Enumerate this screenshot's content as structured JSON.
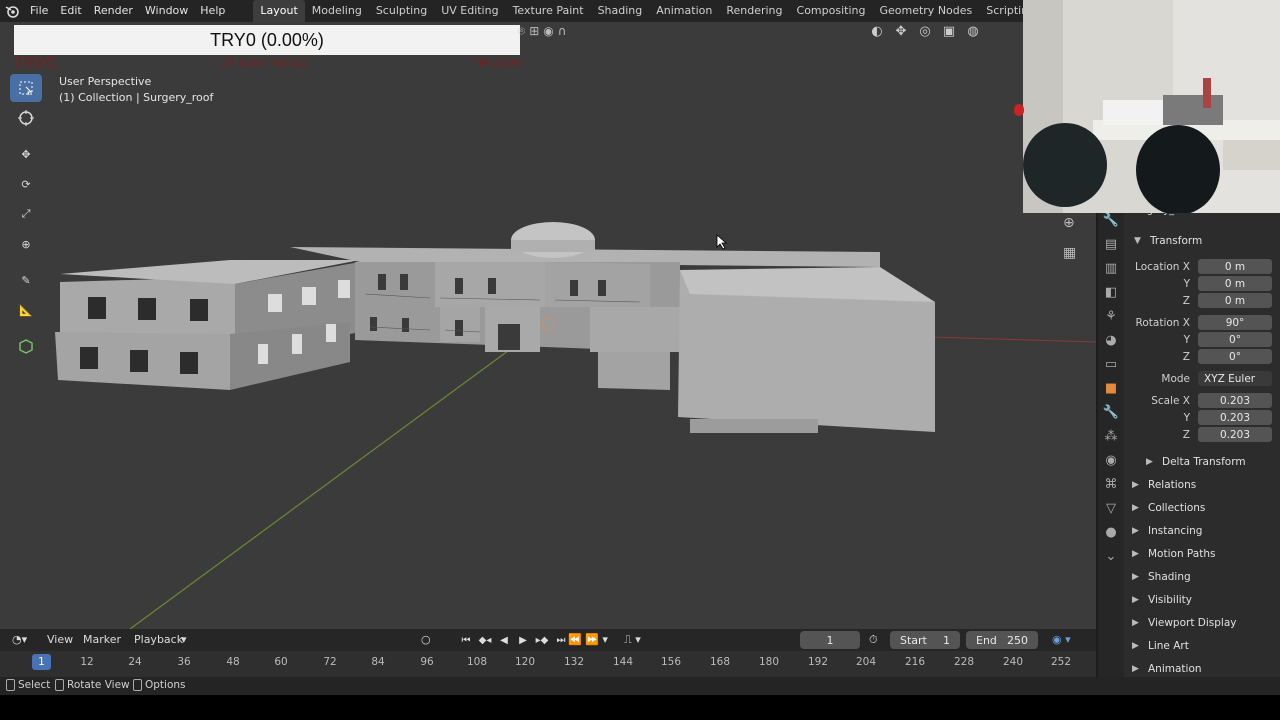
{
  "menubar": {
    "logo_icon": "blender-logo-icon",
    "items": [
      "File",
      "Edit",
      "Render",
      "Window",
      "Help"
    ],
    "workspaces": [
      "Layout",
      "Modeling",
      "Sculpting",
      "UV Editing",
      "Texture Paint",
      "Shading",
      "Animation",
      "Rendering",
      "Compositing",
      "Geometry Nodes",
      "Scripting"
    ],
    "active_workspace": "Layout",
    "add_workspace": "+"
  },
  "overlay": {
    "counter": "TRY0 (0.00%)",
    "try_label": "TRY0",
    "days_label": "27 DAYS TO GO",
    "goal_label": "TRY2500"
  },
  "viewport": {
    "perspective": "User Perspective",
    "collection": "(1) Collection | Surgery_roof"
  },
  "properties": {
    "object_name": "Surgery_roof",
    "transform_title": "Transform",
    "location": {
      "label_x": "Location X",
      "label_y": "Y",
      "label_z": "Z",
      "x": "0 m",
      "y": "0 m",
      "z": "0 m"
    },
    "rotation": {
      "label_x": "Rotation X",
      "label_y": "Y",
      "label_z": "Z",
      "x": "90°",
      "y": "0°",
      "z": "0°"
    },
    "mode": {
      "label": "Mode",
      "value": "XYZ Euler"
    },
    "scale": {
      "label_x": "Scale X",
      "label_y": "Y",
      "label_z": "Z",
      "x": "0.203",
      "y": "0.203",
      "z": "0.203"
    },
    "delta_transform": "Delta Transform",
    "sections": [
      "Relations",
      "Collections",
      "Instancing",
      "Motion Paths",
      "Shading",
      "Visibility",
      "Viewport Display",
      "Line Art",
      "Animation"
    ]
  },
  "timeline": {
    "view": "View",
    "marker": "Marker",
    "playback": "Playback",
    "current_frame": "1",
    "start_label": "Start",
    "start": "1",
    "end_label": "End",
    "end": "250",
    "ticks": [
      "1",
      "12",
      "24",
      "36",
      "48",
      "60",
      "72",
      "84",
      "96",
      "108",
      "120",
      "132",
      "144",
      "156",
      "168",
      "180",
      "192",
      "204",
      "216",
      "228",
      "240",
      "252"
    ]
  },
  "statusbar": {
    "select": "Select",
    "rotate": "Rotate View",
    "options": "Options"
  },
  "colors": {
    "accent": "#4a72b8",
    "active_tab": "#e58a3b",
    "overlay_red": "#7a1e1e"
  }
}
